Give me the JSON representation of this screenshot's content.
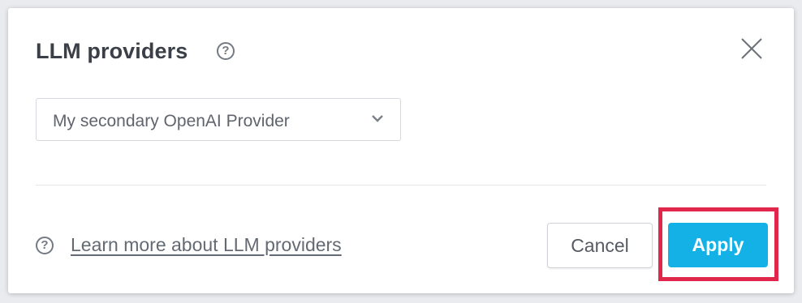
{
  "dialog": {
    "title": "LLM providers",
    "title_help_icon": "question-circle-icon",
    "close_icon": "close-icon"
  },
  "provider_select": {
    "selected_value": "My secondary OpenAI Provider",
    "chevron_icon": "chevron-down-icon"
  },
  "footer": {
    "help_icon": "question-circle-icon",
    "learn_more_label": "Learn more about LLM providers",
    "cancel_label": "Cancel",
    "apply_label": "Apply"
  },
  "colors": {
    "accent": "#14b1e7",
    "highlight": "#e0264a",
    "title_text": "#3b3f47"
  }
}
